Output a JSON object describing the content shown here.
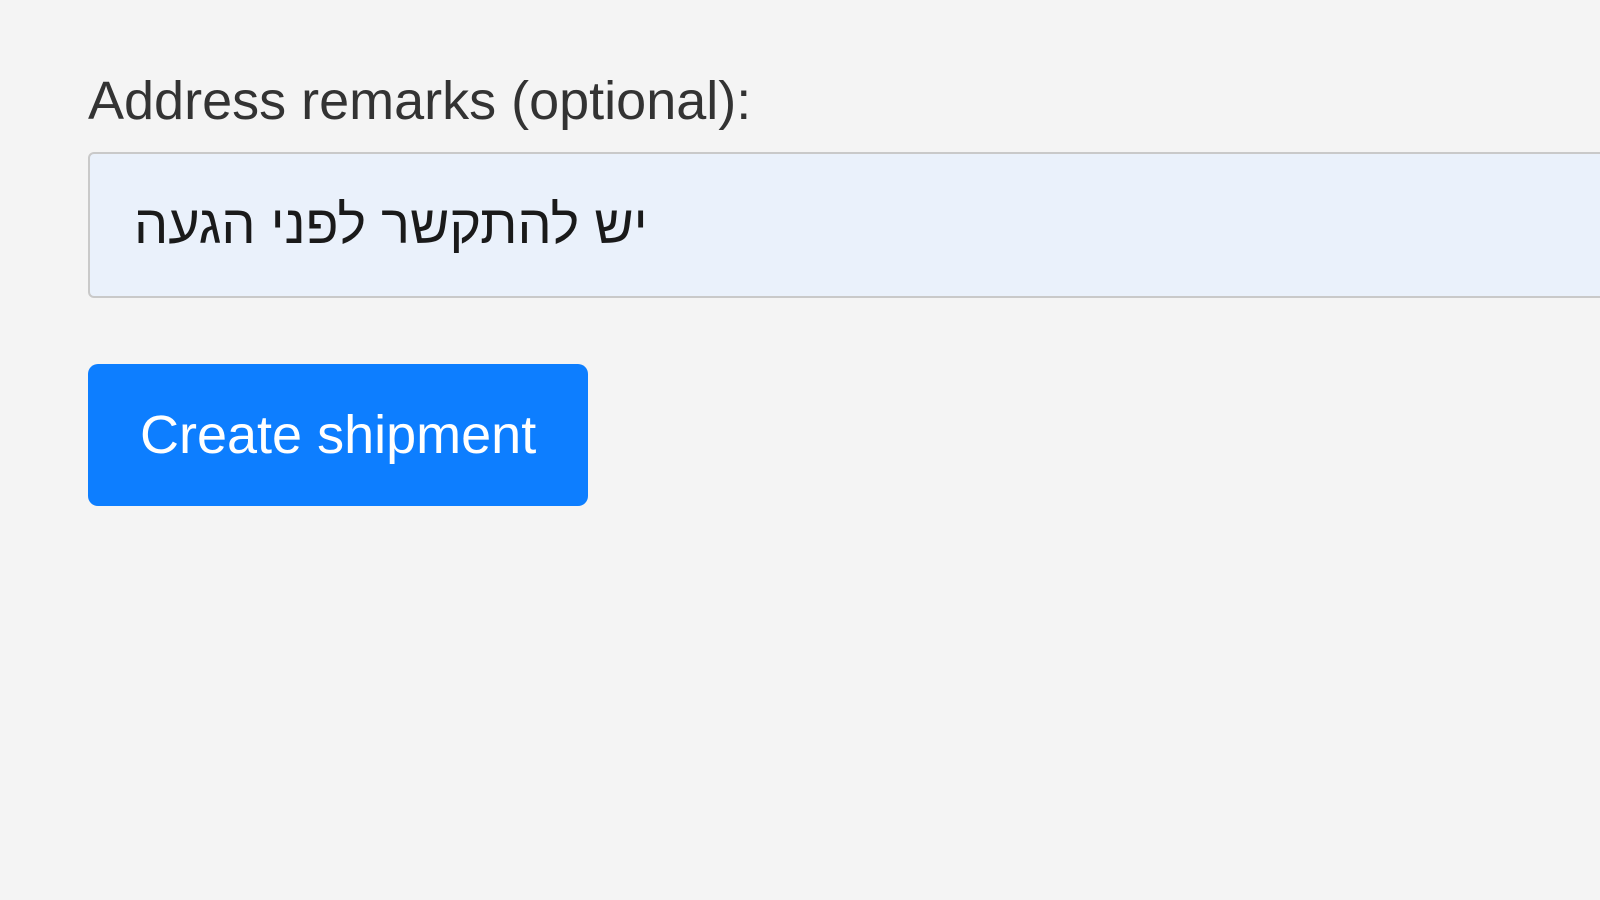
{
  "form": {
    "address_remarks": {
      "label": "Address remarks (optional):",
      "value": "יש להתקשר לפני הגעה"
    },
    "actions": {
      "submit_label": "Create shipment"
    }
  }
}
